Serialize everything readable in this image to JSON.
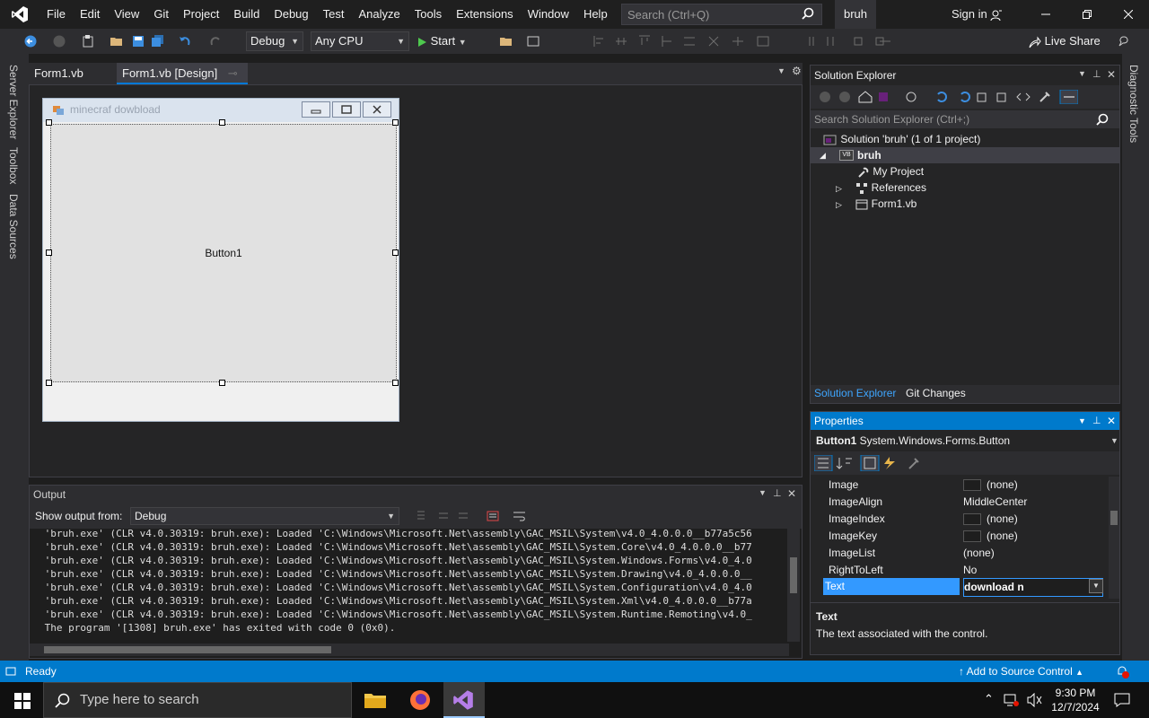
{
  "menu": [
    "File",
    "Edit",
    "View",
    "Git",
    "Project",
    "Build",
    "Debug",
    "Test",
    "Analyze",
    "Tools",
    "Extensions",
    "Window",
    "Help"
  ],
  "search": {
    "placeholder": "Search (Ctrl+Q)"
  },
  "solution_name": "bruh",
  "signin": "Sign in",
  "toolbar": {
    "config": "Debug",
    "platform": "Any CPU",
    "start": "Start",
    "liveshare": "Live Share"
  },
  "left_rail": [
    "Server Explorer",
    "Toolbox",
    "Data Sources"
  ],
  "right_rail": [
    "Diagnostic Tools"
  ],
  "doc_tabs": [
    {
      "label": "Form1.vb"
    },
    {
      "label": "Form1.vb [Design]"
    }
  ],
  "form": {
    "title": "minecraf dowbload",
    "button": "Button1"
  },
  "output": {
    "title": "Output",
    "show_from_label": "Show output from:",
    "source": "Debug",
    "lines": [
      " 'bruh.exe' (CLR v4.0.30319: bruh.exe): Loaded 'C:\\Windows\\Microsoft.Net\\assembly\\GAC_MSIL\\System\\v4.0_4.0.0.0__b77a5c56",
      " 'bruh.exe' (CLR v4.0.30319: bruh.exe): Loaded 'C:\\Windows\\Microsoft.Net\\assembly\\GAC_MSIL\\System.Core\\v4.0_4.0.0.0__b77",
      " 'bruh.exe' (CLR v4.0.30319: bruh.exe): Loaded 'C:\\Windows\\Microsoft.Net\\assembly\\GAC_MSIL\\System.Windows.Forms\\v4.0_4.0",
      " 'bruh.exe' (CLR v4.0.30319: bruh.exe): Loaded 'C:\\Windows\\Microsoft.Net\\assembly\\GAC_MSIL\\System.Drawing\\v4.0_4.0.0.0__",
      " 'bruh.exe' (CLR v4.0.30319: bruh.exe): Loaded 'C:\\Windows\\Microsoft.Net\\assembly\\GAC_MSIL\\System.Configuration\\v4.0_4.0",
      " 'bruh.exe' (CLR v4.0.30319: bruh.exe): Loaded 'C:\\Windows\\Microsoft.Net\\assembly\\GAC_MSIL\\System.Xml\\v4.0_4.0.0.0__b77a",
      " 'bruh.exe' (CLR v4.0.30319: bruh.exe): Loaded 'C:\\Windows\\Microsoft.Net\\assembly\\GAC_MSIL\\System.Runtime.Remoting\\v4.0_",
      " The program '[1308] bruh.exe' has exited with code 0 (0x0)."
    ]
  },
  "solution_explorer": {
    "title": "Solution Explorer",
    "search_placeholder": "Search Solution Explorer (Ctrl+;)",
    "solution": "Solution 'bruh' (1 of 1 project)",
    "project": "bruh",
    "items": [
      "My Project",
      "References",
      "Form1.vb"
    ],
    "tabs": [
      "Solution Explorer",
      "Git Changes"
    ]
  },
  "properties": {
    "title": "Properties",
    "object_name": "Button1",
    "object_type": "System.Windows.Forms.Button",
    "rows": [
      {
        "name": "Image",
        "value": "(none)",
        "swatch": true
      },
      {
        "name": "ImageAlign",
        "value": "MiddleCenter",
        "swatch": false
      },
      {
        "name": "ImageIndex",
        "value": "(none)",
        "swatch": true
      },
      {
        "name": "ImageKey",
        "value": "(none)",
        "swatch": true
      },
      {
        "name": "ImageList",
        "value": "(none)",
        "swatch": false
      },
      {
        "name": "RightToLeft",
        "value": "No",
        "swatch": false
      }
    ],
    "selected": {
      "name": "Text",
      "value": "download n"
    },
    "desc_title": "Text",
    "desc_text": "The text associated with the control."
  },
  "status": {
    "ready": "Ready",
    "source_control": "Add to Source Control"
  },
  "taskbar": {
    "search_placeholder": "Type here to search",
    "time": "9:30 PM",
    "date": "12/7/2024"
  },
  "colors": {
    "accent": "#007acc",
    "vs_purple": "#68217a",
    "selection": "#3399ff"
  }
}
